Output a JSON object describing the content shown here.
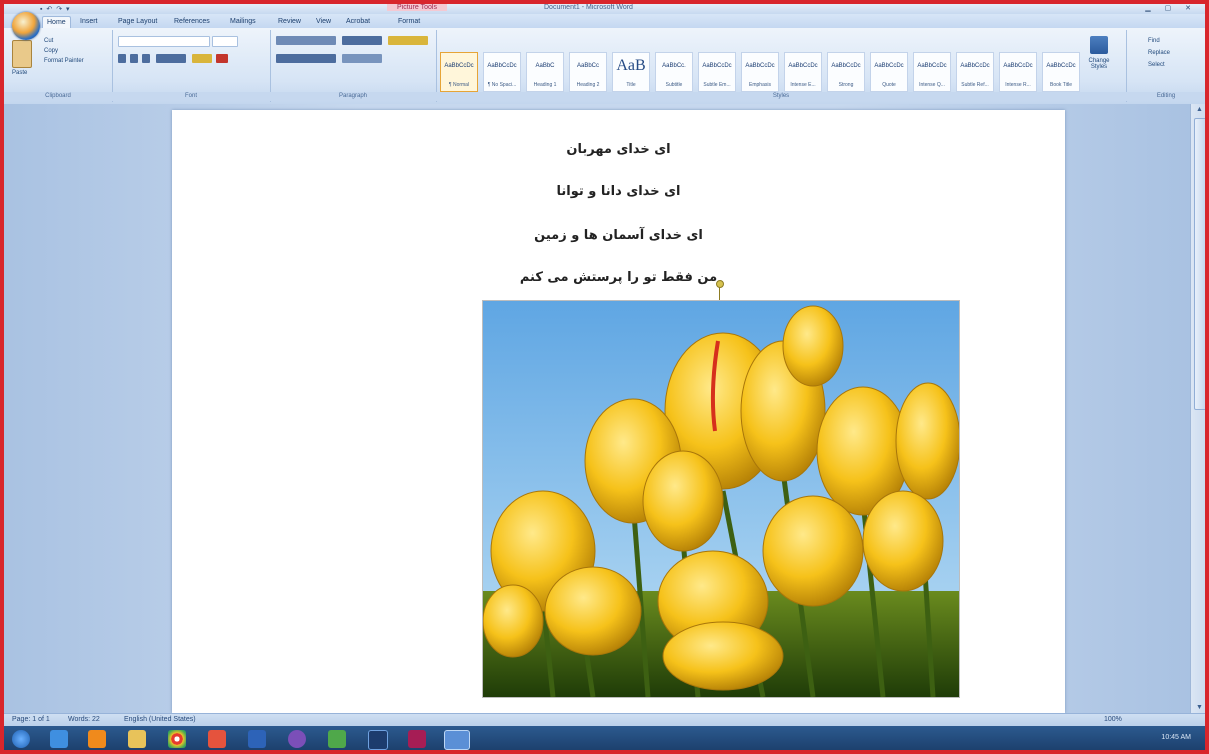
{
  "window": {
    "title": "Document1 - Microsoft Word",
    "context_tab": "Picture Tools",
    "quick_access": "▪ ↶ ↷ ▾",
    "window_buttons": "▁ ▢ ✕"
  },
  "tabs": [
    "Home",
    "Insert",
    "Page Layout",
    "References",
    "Mailings",
    "Review",
    "View",
    "Acrobat",
    "Format"
  ],
  "clipboard": {
    "paste": "Paste",
    "cut": "Cut",
    "copy": "Copy",
    "format_painter": "Format Painter",
    "label": "Clipboard"
  },
  "font_group": {
    "label": "Font"
  },
  "paragraph_group": {
    "label": "Paragraph"
  },
  "styles": {
    "label": "Styles",
    "items": [
      {
        "sample": "AaBbCcDc",
        "name": "¶ Normal"
      },
      {
        "sample": "AaBbCcDc",
        "name": "¶ No Spaci..."
      },
      {
        "sample": "AaBbC",
        "name": "Heading 1"
      },
      {
        "sample": "AaBbCc",
        "name": "Heading 2"
      },
      {
        "sample": "AaB",
        "name": "Title"
      },
      {
        "sample": "AaBbCc.",
        "name": "Subtitle"
      },
      {
        "sample": "AaBbCcDc",
        "name": "Subtle Em..."
      },
      {
        "sample": "AaBbCcDc",
        "name": "Emphasis"
      },
      {
        "sample": "AaBbCcDc",
        "name": "Intense E..."
      },
      {
        "sample": "AaBbCcDc",
        "name": "Strong"
      },
      {
        "sample": "AaBbCcDc",
        "name": "Quote"
      },
      {
        "sample": "AaBbCcDc",
        "name": "Intense Q..."
      },
      {
        "sample": "AaBbCcDc",
        "name": "Subtle Ref..."
      },
      {
        "sample": "AaBbCcDc",
        "name": "Intense R..."
      },
      {
        "sample": "AaBbCcDc",
        "name": "Book Title"
      }
    ],
    "change_styles": "Change Styles"
  },
  "editing": {
    "find": "Find",
    "replace": "Replace",
    "select": "Select",
    "label": "Editing"
  },
  "document": {
    "lines": [
      "ای خدای مهربان",
      "ای خدای دانا و توانا",
      "ای خدای آسمان ها و زمین",
      "من فقط تو را پرستش می کنم"
    ]
  },
  "statusbar": {
    "page": "Page: 1 of 1",
    "words": "Words: 22",
    "language": "English (United States)",
    "zoom": "100%"
  },
  "taskbar": {
    "clock": "10:45 AM",
    "icons": [
      "start-orb",
      "ie",
      "media",
      "explorer",
      "chrome",
      "paint",
      "word",
      "viber",
      "store",
      "photoshop",
      "indesign",
      "active-word"
    ]
  }
}
